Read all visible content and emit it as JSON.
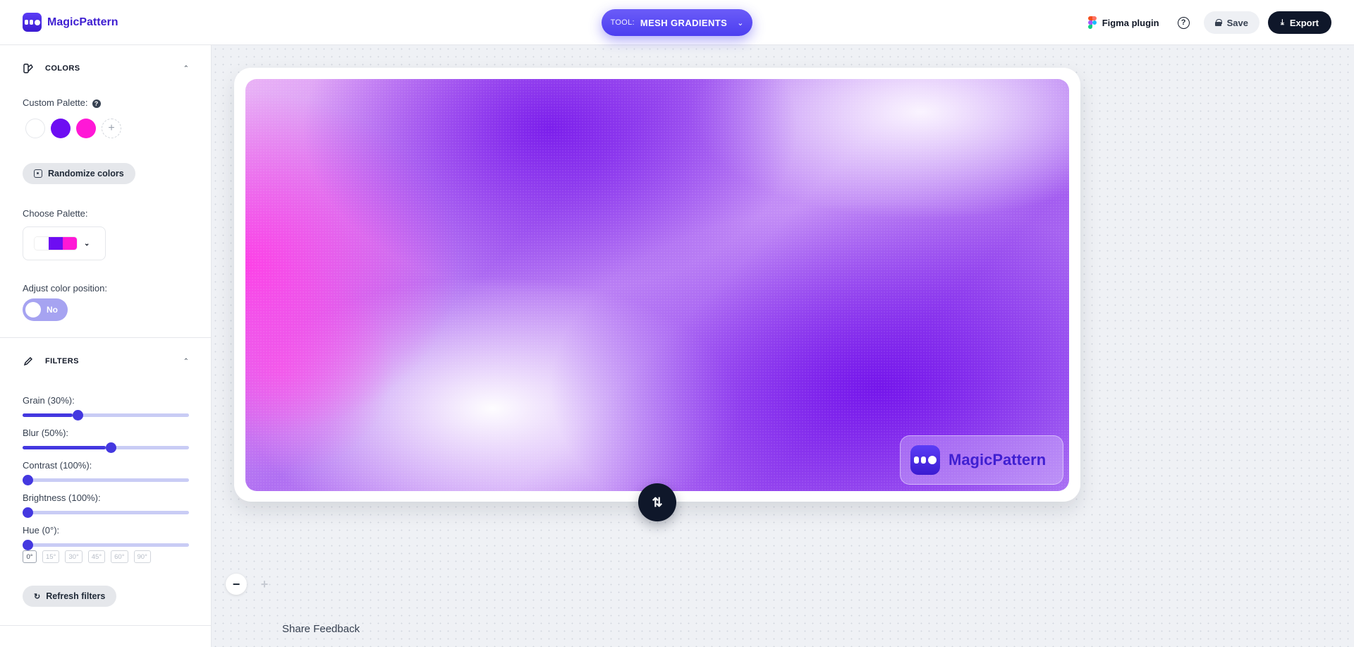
{
  "app": {
    "name": "MagicPattern"
  },
  "header": {
    "tool_prefix": "TOOL:",
    "tool_name": "MESH GRADIENTS",
    "figma_plugin_label": "Figma plugin",
    "save_label": "Save",
    "export_label": "Export"
  },
  "sidebar": {
    "colors": {
      "title": "COLORS",
      "custom_palette_label": "Custom Palette:",
      "swatches": [
        "#ffffff",
        "#6d0df2",
        "#ff18d6"
      ],
      "randomize_label": "Randomize colors",
      "choose_palette_label": "Choose Palette:",
      "palette_preview": [
        "#ffffff",
        "#6d0df2",
        "#ff18d6"
      ],
      "adjust_position_label": "Adjust color position:",
      "toggle_label": "No"
    },
    "filters": {
      "title": "FILTERS",
      "sliders": [
        {
          "label": "Grain (30%):",
          "fraction": 0.3
        },
        {
          "label": "Blur (50%):",
          "fraction": 0.5
        },
        {
          "label": "Contrast (100%):",
          "fraction": 0.0
        },
        {
          "label": "Brightness (100%):",
          "fraction": 0.0
        },
        {
          "label": "Hue (0°):",
          "fraction": 0.0
        }
      ],
      "hue_chips": [
        "0°",
        "15°",
        "30°",
        "45°",
        "60°",
        "90°"
      ],
      "refresh_label": "Refresh filters"
    }
  },
  "canvas": {
    "watermark_text": "MagicPattern",
    "share_feedback_label": "Share Feedback"
  },
  "colors": {
    "accent": "#4438e0",
    "dark": "#0f172a"
  }
}
